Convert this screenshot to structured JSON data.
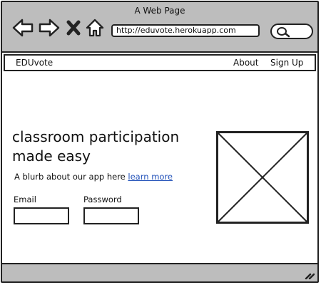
{
  "window": {
    "title": "A Web Page"
  },
  "browser": {
    "url": "http://eduvote.herokuapp.com",
    "icons": [
      "back-arrow-icon",
      "forward-arrow-icon",
      "close-x-icon",
      "home-icon",
      "search-icon"
    ]
  },
  "menubar": {
    "brand": "EDUvote",
    "links": [
      {
        "label": "About"
      },
      {
        "label": "Sign Up"
      }
    ]
  },
  "hero": {
    "headline_line1": "classroom participation",
    "headline_line2": "made easy",
    "blurb_text": "A blurb about our app here",
    "blurb_link": "learn more"
  },
  "form": {
    "email_label": "Email",
    "password_label": "Password"
  },
  "colors": {
    "chrome": "#bdbdbd",
    "link": "#1f4fb8",
    "border": "#222222"
  }
}
